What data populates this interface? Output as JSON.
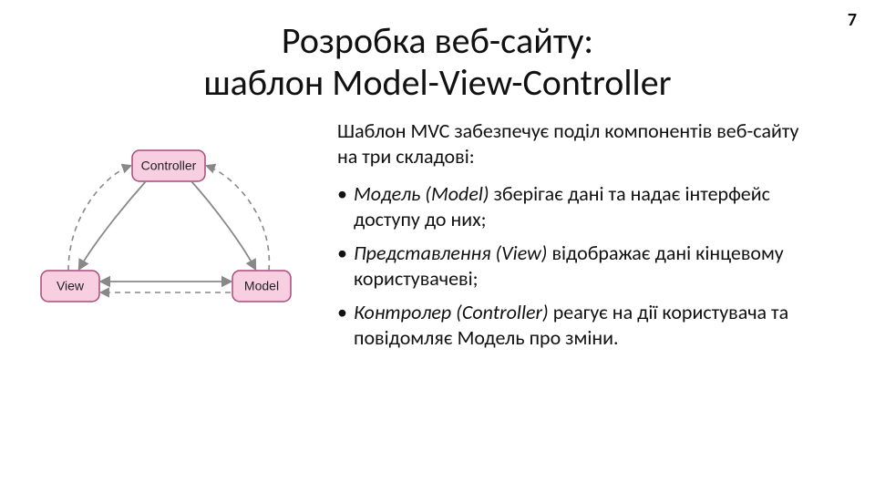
{
  "page_number": "7",
  "title_line1": "Розробка веб-сайту:",
  "title_line2": "шаблон Model-View-Controller",
  "diagram": {
    "nodes": {
      "controller": "Controller",
      "view": "View",
      "model": "Model"
    }
  },
  "intro": "Шаблон MVC забезпечує поділ компонентів веб-сайту на три складові:",
  "bullet_marker": "•",
  "bullets": [
    {
      "term": "Модель (Model)",
      "rest": " зберігає дані та надає інтерфейс доступу до них;"
    },
    {
      "term": "Представлення (View)",
      "rest": " відображає дані кінцевому користувачеві;"
    },
    {
      "term": "Контролер (Controller)",
      "rest": " реагує на дії користувача та повідомляє Модель про зміни."
    }
  ]
}
